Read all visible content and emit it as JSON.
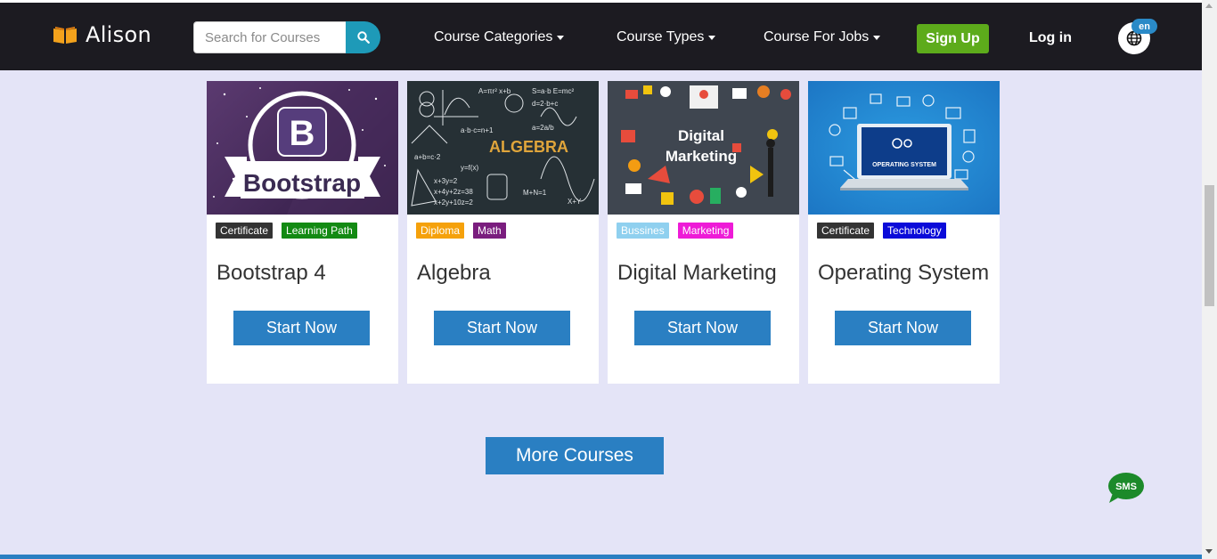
{
  "header": {
    "brand": "Alison",
    "search_placeholder": "Search for Courses",
    "nav": [
      "Course Categories",
      "Course Types",
      "Course For Jobs"
    ],
    "signup_label": "Sign Up",
    "login_label": "Log in",
    "language": "en"
  },
  "courses": [
    {
      "title": "Bootstrap 4",
      "image_text": [
        "Bootstrap"
      ],
      "tags": [
        {
          "label": "Certificate",
          "color": "#333333"
        },
        {
          "label": "Learning Path",
          "color": "#138a13"
        }
      ],
      "cta": "Start Now"
    },
    {
      "title": "Algebra",
      "image_text": [
        "ALGEBRA"
      ],
      "tags": [
        {
          "label": "Diploma",
          "color": "#f5a10b"
        },
        {
          "label": "Math",
          "color": "#7a1d7e"
        }
      ],
      "cta": "Start Now"
    },
    {
      "title": "Digital Marketing",
      "image_text": [
        "Digital",
        "Marketing"
      ],
      "tags": [
        {
          "label": "Bussines",
          "color": "#8fd0ef"
        },
        {
          "label": "Marketing",
          "color": "#ee1bd7"
        }
      ],
      "cta": "Start Now"
    },
    {
      "title": "Operating System",
      "image_text": [
        "OPERATING SYSTEM"
      ],
      "tags": [
        {
          "label": "Certificate",
          "color": "#333333"
        },
        {
          "label": "Technology",
          "color": "#0b0bd9"
        }
      ],
      "cta": "Start Now"
    }
  ],
  "more_courses_label": "More Courses",
  "sms_label": "SMS",
  "colors": {
    "header_bg": "#1c1b21",
    "page_bg": "#e4e4f7",
    "primary_button": "#2a7fc2",
    "signup_button": "#5dab1b",
    "search_button": "#1e9ab8"
  }
}
